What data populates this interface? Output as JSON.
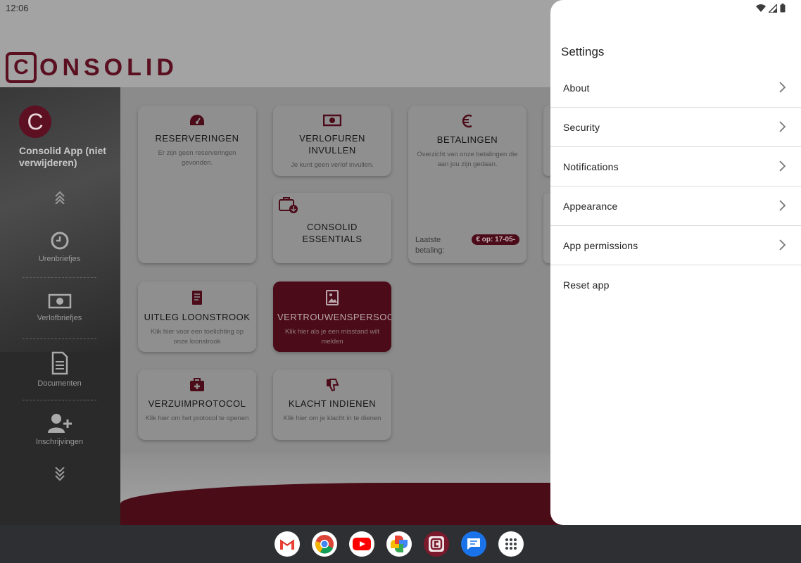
{
  "status_bar": {
    "time": "12:06"
  },
  "app": {
    "logo_letter": "C",
    "logo_text": "ONSOLID",
    "sidebar": {
      "avatar_letter": "C",
      "user_title": "Consolid App (niet verwijderen)",
      "items": [
        {
          "label": "Urenbriefjes",
          "icon": "clock-icon"
        },
        {
          "label": "Verlofbriefjes",
          "icon": "money-icon"
        },
        {
          "label": "Documenten",
          "icon": "document-icon"
        },
        {
          "label": "Inschrijvingen",
          "icon": "add-user-icon"
        }
      ]
    },
    "cards": [
      {
        "title": "RESERVERINGEN",
        "desc": "Er zijn geen reserveringen gevonden.",
        "icon": "dashboard-icon"
      },
      {
        "title": "VERLOFUREN INVULLEN",
        "desc": "Je kunt geen verlof invullen.",
        "icon": "money-icon"
      },
      {
        "title": "BETALINGEN",
        "desc": "Overzicht van onze betalingen die aan jou zijn gedaan.",
        "icon": "euro-icon",
        "pay_label": "Laatste betaling:",
        "pay_badge": "€ op: 17-05-"
      },
      {
        "title": "CONSOLID ESSENTIALS",
        "desc": "",
        "icon": "briefcase-download-icon"
      },
      {
        "title": "UITLEG LOONSTROOK",
        "desc": "Klik hier voor een toelichting op onze loonstrook",
        "icon": "receipt-icon"
      },
      {
        "title": "VERTROUWENSPERSOON",
        "desc": "Klik hier als je een misstand wilt melden",
        "icon": "image-icon"
      },
      {
        "title": "VERZUIMPROTOCOL",
        "desc": "Klik hier om het protocol te openen",
        "icon": "medkit-icon"
      },
      {
        "title": "KLACHT INDIENEN",
        "desc": "Klik hier om je klacht in te dienen",
        "icon": "thumbs-down-icon"
      }
    ]
  },
  "settings": {
    "title": "Settings",
    "items": [
      {
        "label": "About",
        "has_chevron": true
      },
      {
        "label": "Security",
        "has_chevron": true
      },
      {
        "label": "Notifications",
        "has_chevron": true
      },
      {
        "label": "Appearance",
        "has_chevron": true
      },
      {
        "label": "App permissions",
        "has_chevron": true
      },
      {
        "label": "Reset app",
        "has_chevron": false
      }
    ]
  },
  "dock": [
    "gmail-icon",
    "chrome-icon",
    "youtube-icon",
    "photos-icon",
    "consolid-app-icon",
    "messages-icon",
    "app-drawer-icon"
  ],
  "colors": {
    "brand": "#5d1022",
    "panel_bg": "#ffffff",
    "navbar": "#2e2f33"
  }
}
